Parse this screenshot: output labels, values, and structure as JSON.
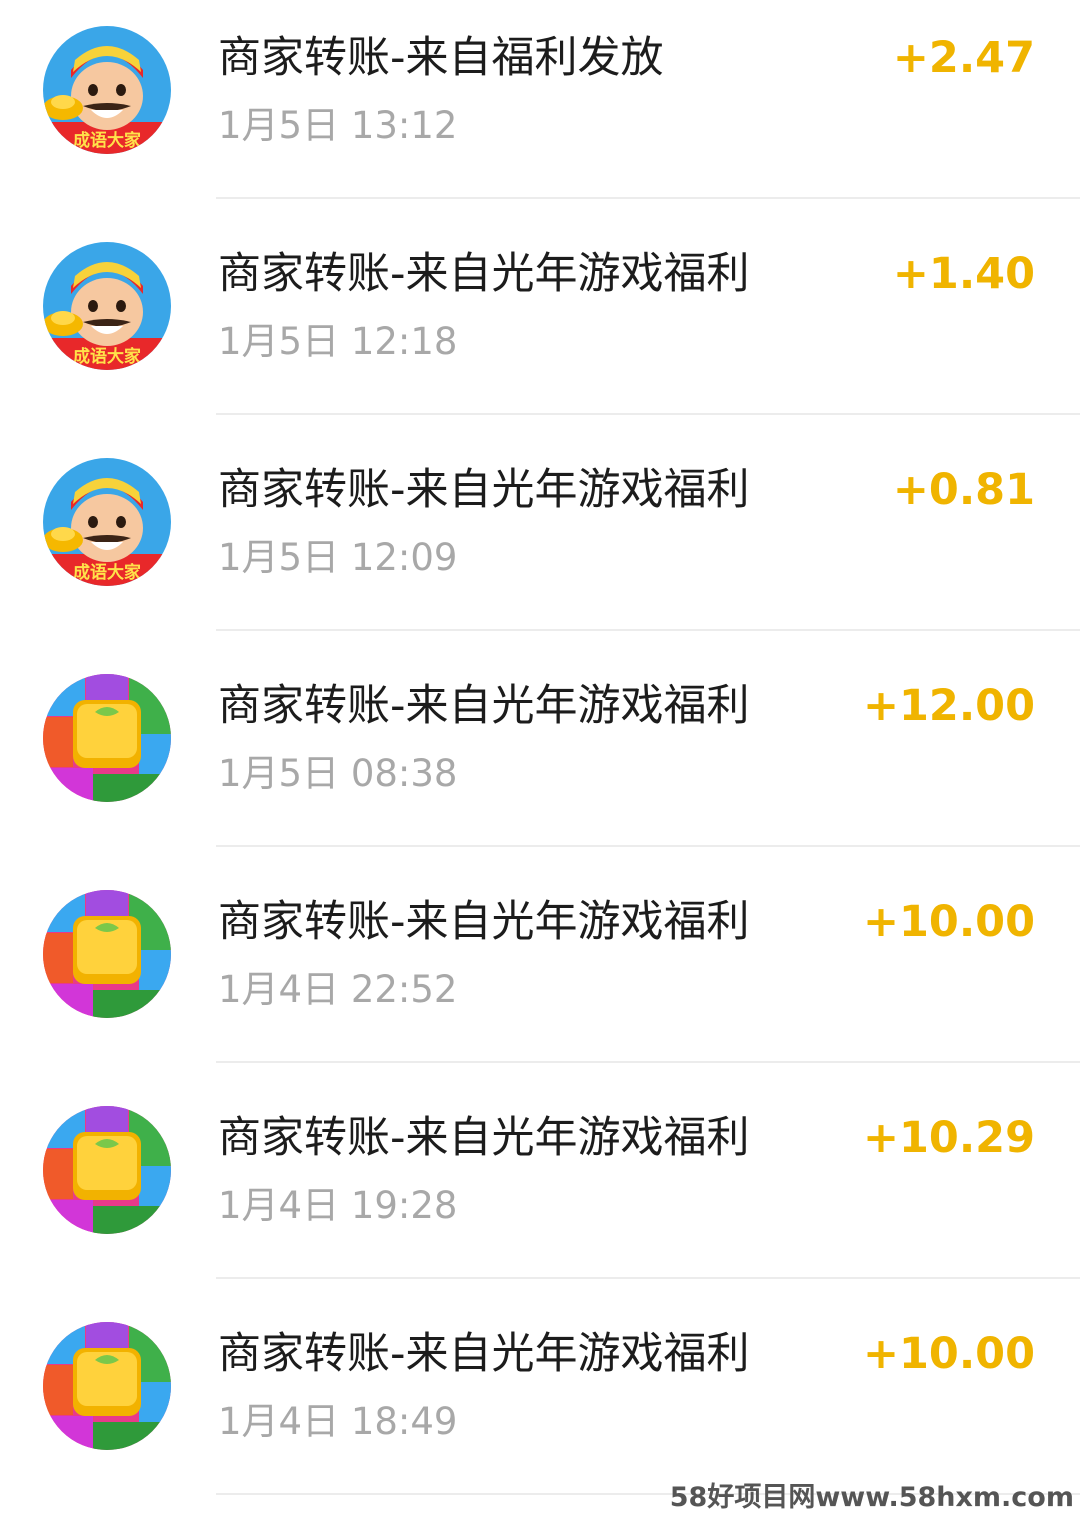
{
  "colors": {
    "amount": "#f0b400",
    "title": "#1c1c1c",
    "time": "#a8a8a8"
  },
  "transactions": [
    {
      "avatar_icon": "god-of-wealth-icon",
      "title": "商家转账-来自福利发放",
      "time": "1月5日 13:12",
      "amount": "+2.47"
    },
    {
      "avatar_icon": "god-of-wealth-icon",
      "title": "商家转账-来自光年游戏福利",
      "time": "1月5日 12:18",
      "amount": "+1.40"
    },
    {
      "avatar_icon": "god-of-wealth-icon",
      "title": "商家转账-来自光年游戏福利",
      "time": "1月5日 12:09",
      "amount": "+0.81"
    },
    {
      "avatar_icon": "fruit-block-icon",
      "title": "商家转账-来自光年游戏福利",
      "time": "1月5日 08:38",
      "amount": "+12.00"
    },
    {
      "avatar_icon": "fruit-block-icon",
      "title": "商家转账-来自光年游戏福利",
      "time": "1月4日 22:52",
      "amount": "+10.00"
    },
    {
      "avatar_icon": "fruit-block-icon",
      "title": "商家转账-来自光年游戏福利",
      "time": "1月4日 19:28",
      "amount": "+10.29"
    },
    {
      "avatar_icon": "fruit-block-icon",
      "title": "商家转账-来自光年游戏福利",
      "time": "1月4日 18:49",
      "amount": "+10.00"
    }
  ],
  "avatar_caption": "成语大家",
  "watermark": "58好项目网www.58hxm.com"
}
